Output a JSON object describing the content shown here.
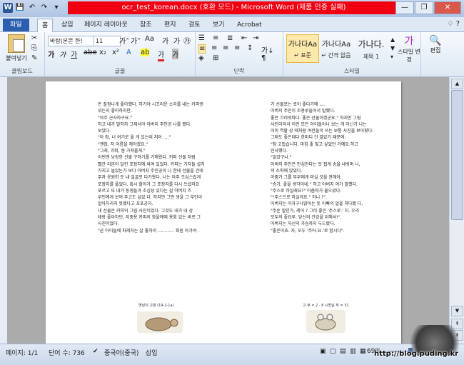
{
  "window": {
    "title": "ocr_test_korean.docx (호환 모드) - Microsoft Word (제품 인증 실패)",
    "minimize_icon": "minimize-icon",
    "maximize_icon": "maximize-icon",
    "close_icon": "close-icon"
  },
  "qat": {
    "word_icon": "W",
    "save": "💾",
    "undo": "↶",
    "redo": "↷",
    "customize": "▾"
  },
  "tabs": [
    {
      "label": "파일"
    },
    {
      "label": "홈"
    },
    {
      "label": "삽입"
    },
    {
      "label": "페이지 레이아웃"
    },
    {
      "label": "참조"
    },
    {
      "label": "편지"
    },
    {
      "label": "검토"
    },
    {
      "label": "보기"
    },
    {
      "label": "Acrobat"
    }
  ],
  "ribbon": {
    "clipboard": {
      "paste_label": "붙여넣기",
      "group_label": "클립보드"
    },
    "font": {
      "font_name": "바탕(본문 한!",
      "font_size": "11",
      "group_label": "글꼴",
      "bold": "가",
      "italic": "가",
      "underline": "가",
      "strike": "abe",
      "sub": "x₂",
      "sup": "x²",
      "grow": "가˄",
      "shrink": "가˅",
      "case": "Aa",
      "clear": "가",
      "highlight": "ab",
      "color": "가",
      "phonetic": "가",
      "enclose": "㉮"
    },
    "paragraph": {
      "group_label": "단락",
      "sort": "가↓",
      "marks": "¶"
    },
    "styles": {
      "group_label": "스타일",
      "items": [
        {
          "sample": "가나다Aa",
          "name": "↵ 표준"
        },
        {
          "sample": "가나다Aa",
          "name": "↵ 간격 없음"
        },
        {
          "sample": "가나다.",
          "name": "제목 1"
        }
      ],
      "change_label": "스타일 변경",
      "edit_label": "편집"
    }
  },
  "document": {
    "left_page_lines": [
      "돈 질정나게 좋아했다. 하기야 시끄러운 소리를 내는 커피엔",
      "위는지 좋아하지만.",
      "\"아주 근사하구요.\"",
      "하고 내가 말하자 그제서야 아버지 주인공 나를 봤다.",
      "보았다.",
      "\"아 참, 너 여기로 올 게 있는데 저어 ....\"",
      "\"괜찮, 저 이름을 해야겠요.\"",
      "\"그래, 괴뢰, 좀 가져올게.\"",
      "이번엔 낭랑한 선물 구하기를 기해왔다. 커피 선물 처럼",
      "빨간 리본이 달린 포장지에 싸여 있었다. 커피는 기자들 설치",
      "가지고 놀았는가 보다 아버지 주인공이 나 한테 선물을 건네",
      "주자 응원한 듯 내 얼굴로 다가왔다. 나는 아주 조심스럽게",
      "포장지를 풀었다. 혹시 할아가 그 포장지를 다시 쓰셨지요",
      "포르고 또 내가 동생들과 조심성 있다는 걸 아버지 즈",
      "부인에게 보여 주고도 싶었 다. 하지만 그런 생을 그 부인이",
      "알아차리지 못했다고 포포공자.",
      "내 선물은 커피의 그림 사진이었다. 그것도 내가 내 상",
      "태랑 좋아하던, 지중용 커피의 화을에에 용회 있는 바로 그",
      "사진이었다.",
      "\"곧 아이들에 파레처는 살 좋하이 ............ 회원 아가야 ."
    ],
    "right_page_lines": [
      "가 선물로는 로이 좋다기에 ....",
      "아버지 주인이 조용루들어서 말했다.",
      "좋은 끄러워따다. 좋은 선물이겠군요.\" 하지만 그림",
      "사진이라서 이런 모든 아이들이나 보는 게 아닌가 나는",
      "이미 역할 상 때처럼 여전들이 쓰는 보통 사진을 보아왔다.",
      "그래도 좋은데다 한마디 건 말았기 때문에.",
      "\"참 고맙습니다. 마침 좋 빛고 싶었던 거예요.하고",
      "인사했다.",
      "\"알았구나.\"",
      "아버지 주인은 안심한다는 듯 접게 송을 내쉬며 나,",
      "의 소파에 앉았다.",
      "아줌가 그를 부부에게 마실 것을 권해야.",
      "\"송기, 좋을 생각이네.\" 하고 아버지 여가 말했다.",
      "\"주스로 하실래요?\" 아줌마가 물으셨다.",
      "\"\"주스으로 하실게요.\" 하니 ?\".",
      "아버지는 이자구나밝아는 듯 아빠의 얼을 쳐다봤 다,",
      "\"주순 말인가, 레어 ? 그러 좋은 '주스로.' 지. 우리",
      "모두의 좋요루. 당신의 건강을 위해서!\".",
      "아버지는 자신의 가슴까지 두드렸다.",
      "\"좋은이죠. 자, 모두 '주어-요.'로 합시다\"."
    ],
    "left_caption": "옛날의 고향 (19-2-1a)",
    "right_caption": "고 후 = 2 · 8   시방날 부 = 31"
  },
  "status": {
    "page": "페이지: 1/1",
    "words": "단어 수: 736",
    "language": "중국어(중국)",
    "mode": "삽입",
    "zoom": "69%"
  },
  "watermark": {
    "url": "http://blog.puding.kr"
  }
}
